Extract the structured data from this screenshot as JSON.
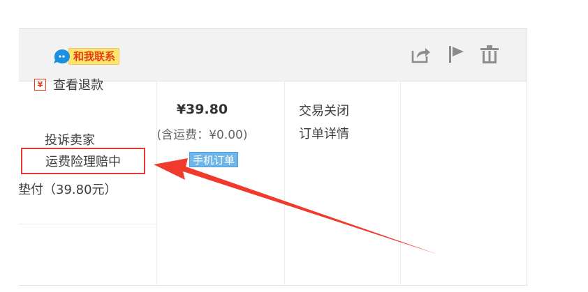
{
  "header": {
    "contact_label": "和我联系",
    "icons": [
      "share-icon",
      "flag-icon",
      "trash-icon"
    ]
  },
  "actions": {
    "view_refund": "查看退款",
    "complain_seller": "投诉卖家",
    "shipping_insurance_claim": "运费险理赔中",
    "advance_payment": "垫付（39.80元）"
  },
  "payment": {
    "price": "¥39.80",
    "shipping_note": "(含运费：¥0.00)",
    "mobile_order_badge": "手机订单"
  },
  "status": {
    "state": "交易关闭",
    "order_detail_link": "订单详情"
  },
  "colors": {
    "highlight_box": "#e53935",
    "arrow": "#f03a2e",
    "badge_blue": "#6fb6e8",
    "contact_bg": "#fce56e"
  }
}
